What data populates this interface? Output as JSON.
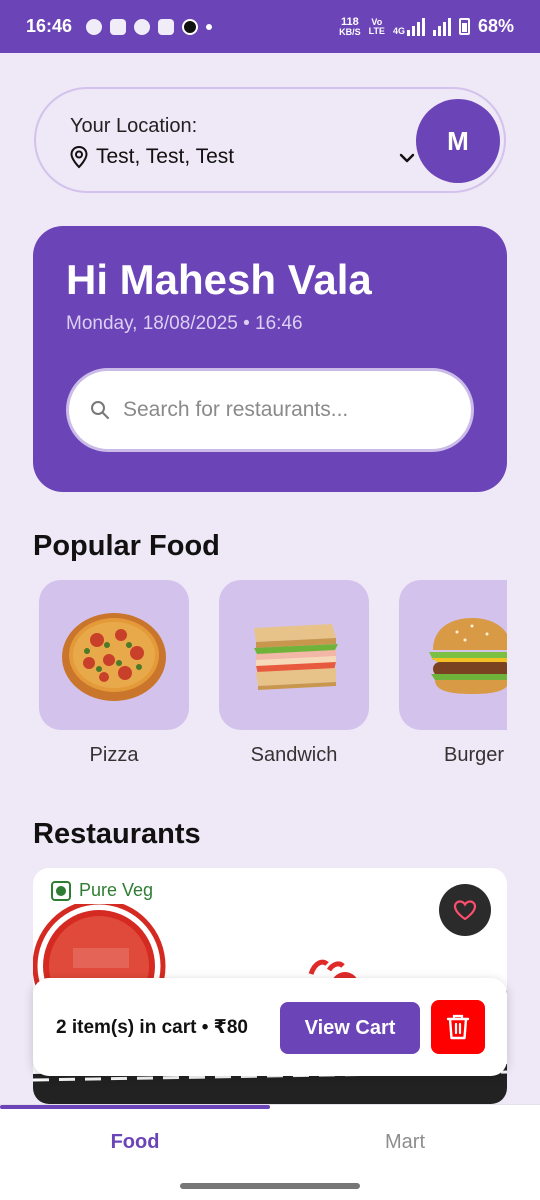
{
  "status_bar": {
    "time": "16:46",
    "net_speed_value": "118",
    "net_speed_unit": "KB/S",
    "volte_top": "Vo",
    "volte_bottom": "LTE",
    "network_type": "4G",
    "battery_percent": "68%"
  },
  "location": {
    "label": "Your Location:",
    "value": "Test, Test, Test",
    "avatar_initial": "M"
  },
  "hero": {
    "greeting": "Hi Mahesh Vala",
    "datetime": "Monday, 18/08/2025 • 16:46",
    "search_placeholder": "Search for restaurants..."
  },
  "popular_food": {
    "title": "Popular Food",
    "items": [
      {
        "label": "Pizza",
        "icon": "pizza-icon"
      },
      {
        "label": "Sandwich",
        "icon": "sandwich-icon"
      },
      {
        "label": "Burger",
        "icon": "burger-icon"
      }
    ]
  },
  "restaurants": {
    "title": "Restaurants",
    "card": {
      "badge": "Pure Veg"
    }
  },
  "cart": {
    "summary": "2 item(s) in cart • ₹80",
    "view_cart_label": "View Cart"
  },
  "bottom_nav": {
    "tabs": [
      {
        "label": "Food",
        "active": true
      },
      {
        "label": "Mart",
        "active": false
      }
    ]
  },
  "colors": {
    "primary": "#6b44b8",
    "background": "#efe8f6",
    "tile": "#d3c3ec",
    "delete": "#ff0000",
    "veg": "#2e7d32"
  }
}
